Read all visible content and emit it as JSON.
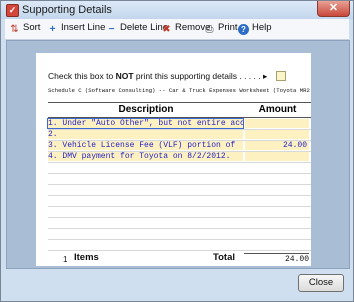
{
  "window": {
    "title": "Supporting Details",
    "close_glyph": "✕",
    "title_icon": "check-mark-icon"
  },
  "toolbar": [
    {
      "label": "Sort",
      "icon": "sort-az-icon",
      "glyph": "⇅"
    },
    {
      "label": "Insert Line",
      "icon": "insert-line-icon",
      "glyph": "+"
    },
    {
      "label": "Delete Line",
      "icon": "delete-line-icon",
      "glyph": "−"
    },
    {
      "label": "Remove",
      "icon": "remove-x-icon",
      "glyph": "✖"
    },
    {
      "label": "Print",
      "icon": "printer-icon",
      "glyph": "⎙"
    },
    {
      "label": "Help",
      "icon": "help-question-icon",
      "glyph": "?"
    }
  ],
  "form": {
    "check_text_before": "Check this box to ",
    "check_text_bold": "NOT",
    "check_text_after": " print this supporting details . . . . . ▸",
    "schedule_line": "Schedule C (Software Consulting) -- Car & Truck Expenses Worksheet (Toyota MR2 S",
    "header_description": "Description",
    "header_amount": "Amount",
    "rows": [
      {
        "desc": "1. Under \"Auto Other\", but not entire acc",
        "amt": ""
      },
      {
        "desc": "2.",
        "amt": ""
      },
      {
        "desc": "3. Vehicle License Fee (VLF) portion of",
        "amt": "24.00"
      },
      {
        "desc": "4. DMV payment for Toyota on 8/2/2012.",
        "amt": ""
      },
      {
        "desc": "",
        "amt": ""
      },
      {
        "desc": "",
        "amt": ""
      },
      {
        "desc": "",
        "amt": ""
      },
      {
        "desc": "",
        "amt": ""
      },
      {
        "desc": "",
        "amt": ""
      },
      {
        "desc": "",
        "amt": ""
      },
      {
        "desc": "",
        "amt": ""
      },
      {
        "desc": "",
        "amt": ""
      }
    ],
    "item_count": "1",
    "items_label": "Items",
    "total_label": "Total",
    "total_value": "24.00"
  },
  "buttons": {
    "close": "Close"
  },
  "colors": {
    "accent_fill": "#fdf1c2",
    "input_text": "#1f1fc8"
  }
}
